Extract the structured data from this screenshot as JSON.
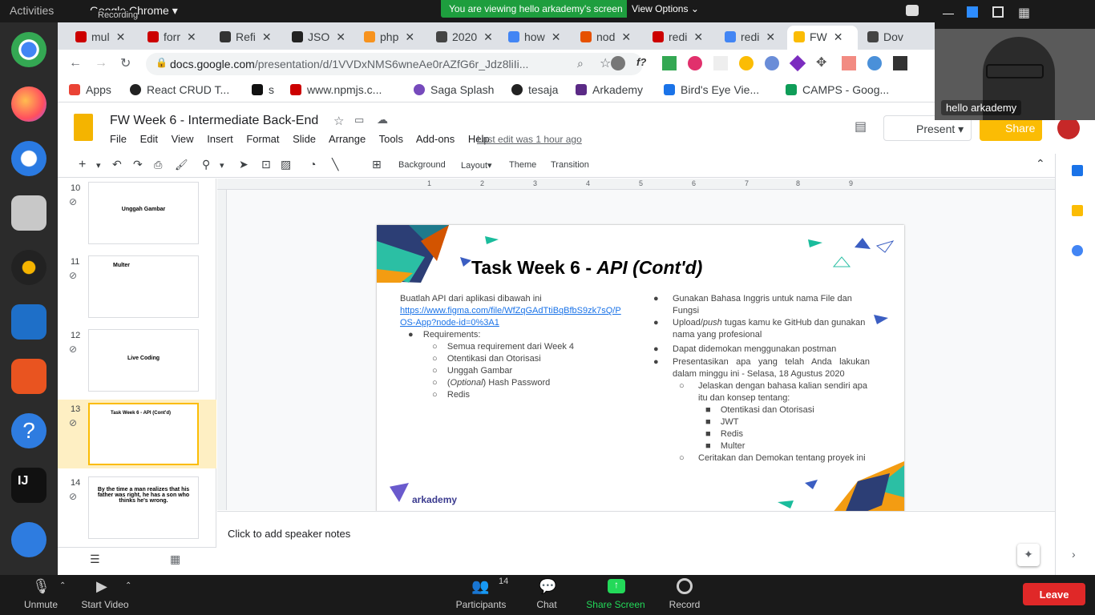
{
  "os": {
    "activities": "Activities",
    "app_name": "Google Chrome",
    "recording": "Recording",
    "view_badge": "You are viewing hello arkademy's screen",
    "view_options": "View Options"
  },
  "tabs": [
    {
      "label": "mul",
      "color": "#c00"
    },
    {
      "label": "forr",
      "color": "#c00"
    },
    {
      "label": "Refi",
      "color": "#333"
    },
    {
      "label": "JSO",
      "color": "#222"
    },
    {
      "label": "php",
      "color": "#f7931e"
    },
    {
      "label": "2020",
      "color": "#444"
    },
    {
      "label": "how",
      "color": "#4285f4"
    },
    {
      "label": "nod",
      "color": "#e65100"
    },
    {
      "label": "redi",
      "color": "#c00"
    },
    {
      "label": "redi",
      "color": "#4285f4"
    },
    {
      "label": "FW",
      "color": "#fbbc04"
    },
    {
      "label": "Dov",
      "color": "#444"
    }
  ],
  "address": {
    "domain": "docs.google.com",
    "path": "/presentation/d/1VVDxNMS6wneAe0rAZfG6r_Jdz8liIi..."
  },
  "bookmarks": [
    {
      "label": "Apps",
      "color": "#ea4335"
    },
    {
      "label": "React CRUD T...",
      "color": "#222"
    },
    {
      "label": "s",
      "color": "#111"
    },
    {
      "label": "www.npmjs.c...",
      "color": "#c00"
    },
    {
      "label": "Saga Splash",
      "color": "#764abc"
    },
    {
      "label": "tesaja",
      "color": "#222"
    },
    {
      "label": "Arkademy",
      "color": "#5b2a86"
    },
    {
      "label": "Bird's Eye Vie...",
      "color": "#1a73e8"
    },
    {
      "label": "CAMPS - Goog...",
      "color": "#0f9d58"
    }
  ],
  "doc": {
    "title": "FW Week 6 - Intermediate Back-End",
    "menu": [
      "File",
      "Edit",
      "View",
      "Insert",
      "Format",
      "Slide",
      "Arrange",
      "Tools",
      "Add-ons",
      "Help"
    ],
    "last_edit": "Last edit was 1 hour ago",
    "present": "Present",
    "share": "Share"
  },
  "toolbar": {
    "background": "Background",
    "layout": "Layout",
    "theme": "Theme",
    "transition": "Transition"
  },
  "filmstrip": [
    {
      "num": "10",
      "title": "Unggah Gambar"
    },
    {
      "num": "11",
      "title": "Multer"
    },
    {
      "num": "12",
      "title": "Live Coding"
    },
    {
      "num": "13",
      "title": "Task Week 6 - API (Cont'd)"
    },
    {
      "num": "14",
      "title": "By the time a man realizes that his father was right, he has a son who thinks he's wrong."
    }
  ],
  "ruler": [
    "1",
    "2",
    "3",
    "4",
    "5",
    "6",
    "7",
    "8",
    "9"
  ],
  "slide": {
    "title_main": "Task Week 6 - ",
    "title_italic": "API (Cont'd)",
    "left_intro": "Buatlah API dari aplikasi dibawah ini",
    "left_link": "https://www.figma.com/file/WfZqGAdTtiBqBfbS9zk7sQ/POS-App?node-id=0%3A1",
    "left_req": "Requirements:",
    "left_items": [
      "Semua requirement dari Week 4",
      "Otentikasi dan Otorisasi",
      "Unggah Gambar",
      "Hash Password",
      "Redis"
    ],
    "left_optional": "Optional",
    "right_b1": "Gunakan Bahasa Inggris untuk nama File dan Fungsi",
    "right_b2_pre": "Upload/",
    "right_b2_italic": "push",
    "right_b2_post": " tugas kamu ke GitHub dan gunakan nama yang profesional",
    "right_b3": "Dapat didemokan menggunakan postman",
    "right_b4": "Presentasikan apa yang telah Anda lakukan dalam minggu ini - Selasa, 18 Agustus 2020",
    "right_sub1": "Jelaskan dengan bahasa kalian sendiri apa itu dan konsep tentang:",
    "right_sub1_items": [
      "Otentikasi dan Otorisasi",
      "JWT",
      "Redis",
      "Multer"
    ],
    "right_sub2": "Ceritakan dan Demokan tentang proyek ini",
    "logo": "arkademy"
  },
  "speaker_notes": "Click to add speaker notes",
  "video": {
    "label": "hello arkademy"
  },
  "zoom": {
    "unmute": "Unmute",
    "start_video": "Start Video",
    "participants": "Participants",
    "participants_count": "14",
    "chat": "Chat",
    "share_screen": "Share Screen",
    "record": "Record",
    "leave": "Leave"
  }
}
